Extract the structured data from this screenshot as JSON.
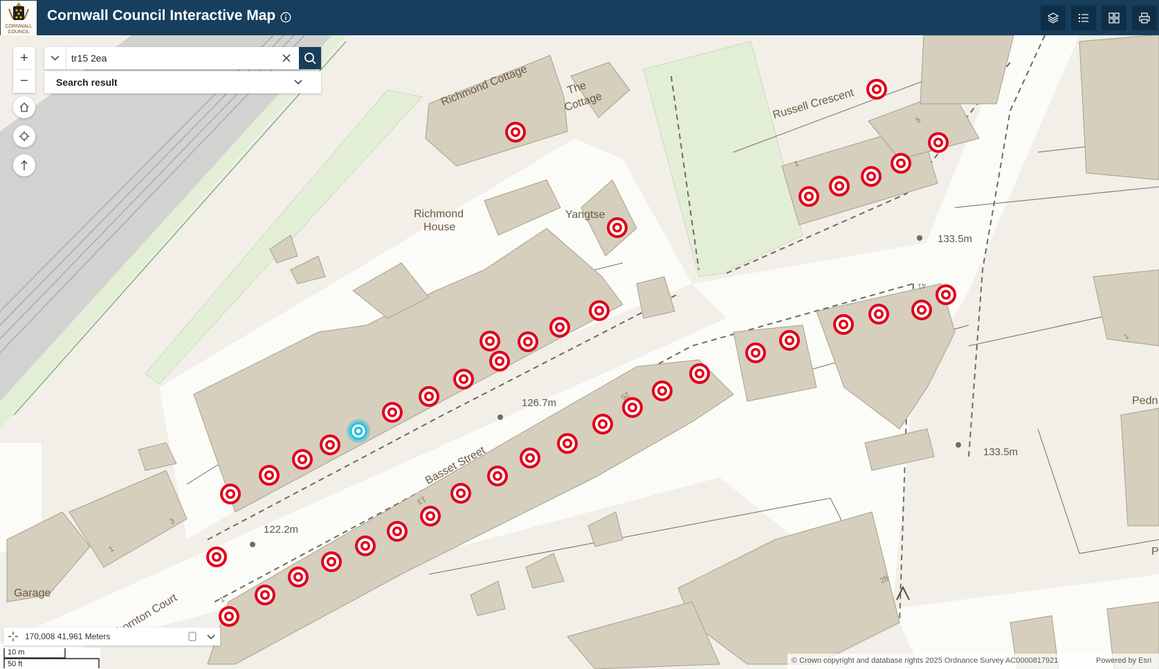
{
  "header": {
    "title": "Cornwall Council Interactive Map",
    "logo_text": "CORNWALL COUNCIL",
    "info_icon": "info-icon",
    "buttons": [
      {
        "name": "layers-button",
        "icon": "layers-icon"
      },
      {
        "name": "legend-button",
        "icon": "list-icon"
      },
      {
        "name": "basemap-gallery-button",
        "icon": "grid-icon"
      },
      {
        "name": "print-button",
        "icon": "printer-icon"
      }
    ]
  },
  "search": {
    "value": "tr15 2ea",
    "placeholder": "",
    "result_label": "Search result"
  },
  "controls": {
    "zoom_in": "+",
    "zoom_out": "−"
  },
  "map": {
    "place_labels": {
      "richmond_cottage": "Richmond Cottage",
      "the_cottage_1": "The",
      "the_cottage_2": "Cottage",
      "richmond_house_1": "Richmond",
      "richmond_house_2": "House",
      "yangtse": "Yangtse",
      "russell_crescent": "Russell Crescent",
      "basset_street": "Basset Street",
      "thornton_court": "Thornton Court",
      "garage": "Garage",
      "pedn": "Pedn",
      "p": "P"
    },
    "spot_heights": [
      "133.5m",
      "126.7m",
      "133.5m",
      "122.2m"
    ],
    "house_numbers": [
      "1",
      "3",
      "13",
      "25",
      "28",
      "41",
      "1",
      "1",
      "5",
      "1"
    ],
    "colors": {
      "marker_red": "#e0001b",
      "selected_marker": "#2bc1de",
      "building": "#d6cfbd",
      "road": "#fbfbf8",
      "green": "#e3eed7",
      "rail": "#c0c0c0"
    }
  },
  "coordinates": {
    "text": "170,008 41,961 Meters"
  },
  "scalebar": {
    "metric": "10 m",
    "imperial": "50 ft"
  },
  "attribution": {
    "text": "© Crown copyright and database rights 2025 Ordnance Survey AC0000817921",
    "powered_by": "Powered by Esri"
  }
}
